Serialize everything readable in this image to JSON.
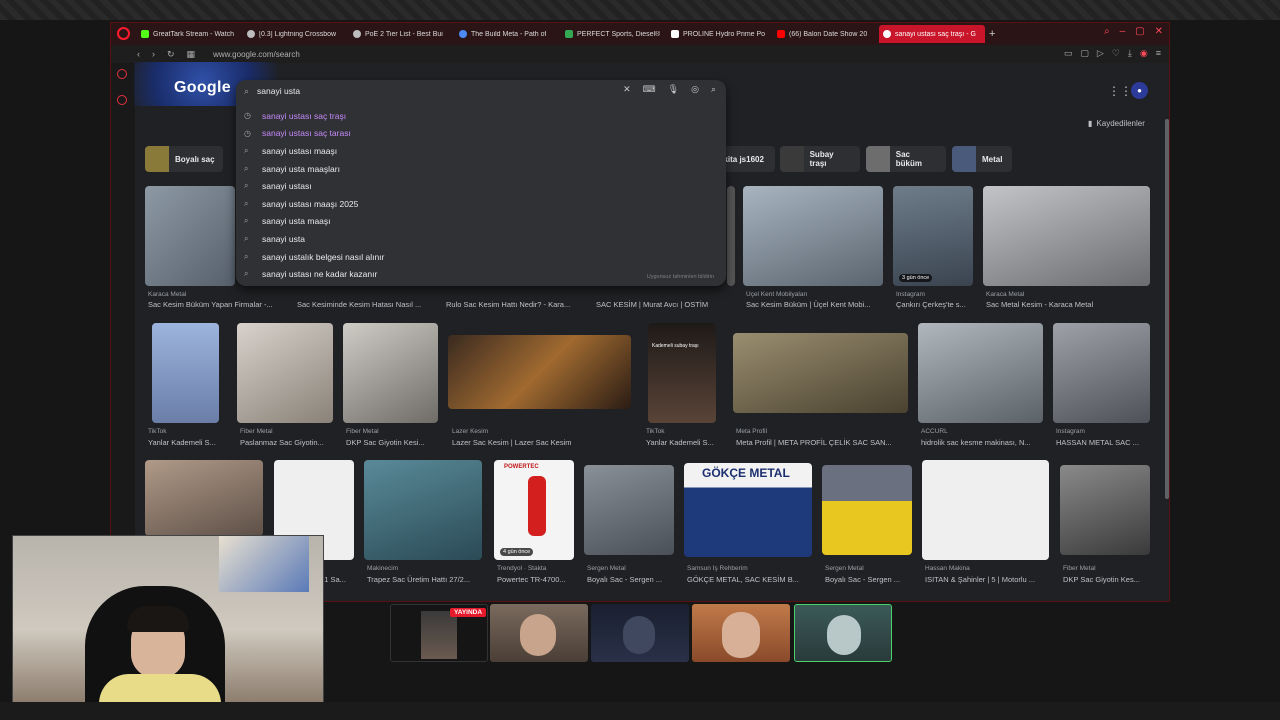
{
  "browser": {
    "tabs": [
      {
        "title": "GreatTark Stream - Watch",
        "color": "#53fc18"
      },
      {
        "title": "[0.3] Lightning Crossbow",
        "color": "#bdbdbd"
      },
      {
        "title": "PoE 2 Tier List - Best Bui",
        "color": "#bdbdbd"
      },
      {
        "title": "The Build Meta - Path of",
        "color": "#4c8bf5"
      },
      {
        "title": "PERFECT Sports, Diesel®",
        "color": "#34a853"
      },
      {
        "title": "PROLINE Hydro Prime Po",
        "color": "#ffffff"
      },
      {
        "title": "(66) Balon Date Show 20",
        "color": "#ff0000"
      },
      {
        "title": "sanayi ustası saç traşı - G",
        "color": "#ffffff"
      }
    ],
    "url": "www.google.com/search"
  },
  "google": {
    "logo": "Google",
    "saved_label": "Kaydedilenler",
    "avatar_letter": "●"
  },
  "search": {
    "query": "sanayi usta",
    "suggestions": [
      {
        "text": "sanayi ustası saç traşı",
        "type": "history"
      },
      {
        "text": "sanayi ustası saç tarası",
        "type": "history"
      },
      {
        "text": "sanayi ustası maaşı",
        "type": "search"
      },
      {
        "text": "sanayi usta maaşları",
        "type": "search"
      },
      {
        "text": "sanayi ustası",
        "type": "search"
      },
      {
        "text": "sanayi ustası maaşı 2025",
        "type": "search"
      },
      {
        "text": "sanayi usta maaşı",
        "type": "search"
      },
      {
        "text": "sanayi usta",
        "type": "search"
      },
      {
        "text": "sanayi ustalık belgesi nasıl alınır",
        "type": "search"
      },
      {
        "text": "sanayi ustası ne kadar kazanır",
        "type": "search"
      }
    ],
    "footer": "Uygunsuz tahminleri bildirin"
  },
  "chips": [
    {
      "label": "Boyalı saç",
      "color": "#8a7a3a"
    },
    {
      "label": "akita js1602",
      "color": "#5a5a5a"
    },
    {
      "label": "Subay traşı",
      "color": "#3a3a3a"
    },
    {
      "label": "Sac büküm",
      "color": "#6d6d6d"
    },
    {
      "label": "Metal",
      "color": "#4a5a7a"
    }
  ],
  "results": {
    "row1": [
      {
        "caption": "Sac Kesim Büküm Yapan Firmalar -...",
        "source": "Karaca Metal",
        "color": "#6a7480"
      },
      {
        "caption": "Sac Kesiminde Kesim Hatası Nasıl ...",
        "source": "",
        "color": "#4a4a4a"
      },
      {
        "caption": "Rulo Sac Kesim Hattı Nedir? - Kara...",
        "source": "",
        "color": "#4a4a4a"
      },
      {
        "caption": "SAC KESİM | Murat Avcı | OSTİM",
        "source": "",
        "color": "#4a4a4a"
      },
      {
        "caption": "Sac Kesim Büküm | Üçel Kent Mobi...",
        "source": "Üçel Kent Mobilyaları",
        "color": "#7a8590"
      },
      {
        "caption": "Çankırı Çerkeş'te s...",
        "source": "Instagram",
        "color": "#5c6a78",
        "badge": "3 gün önce"
      },
      {
        "caption": "Sac Metal Kesim - Karaca Metal",
        "source": "Karaca Metal",
        "color": "#8c8e92"
      }
    ],
    "row2": [
      {
        "caption": "Yanlar Kademeli S...",
        "source": "TikTok",
        "color": "#8aa0c8"
      },
      {
        "caption": "Paslanmaz Sac Giyotin...",
        "source": "Fiber Metal",
        "color": "#b8b2ac"
      },
      {
        "caption": "DKP Sac Giyotin Kesi...",
        "source": "Fiber Metal",
        "color": "#9c9892"
      },
      {
        "caption": "Lazer Sac Kesim | Lazer Sac Kesim",
        "source": "Lazer Kesim",
        "color": "#5a4030"
      },
      {
        "caption": "Yanlar Kademeli S...",
        "source": "TikTok",
        "color": "#3a2a24",
        "overlay": "Kademeli subay traşı"
      },
      {
        "caption": "Meta Profil | META PROFİL ÇELİK SAC SAN...",
        "source": "Meta Profil",
        "color": "#7a7056"
      },
      {
        "caption": "hidrolik sac kesme makinası, N...",
        "source": "ACCURL",
        "color": "#8a9298"
      },
      {
        "caption": "HASSAN METAL SAC ...",
        "source": "Instagram",
        "color": "#7a7e84"
      }
    ],
    "row3": [
      {
        "caption": "",
        "source": "",
        "color": "#9a8a7a"
      },
      {
        "caption": "...1 Sa...",
        "source": "",
        "color": "#e8e8e8"
      },
      {
        "caption": "Trapez Sac Üretim Hattı 27/2...",
        "source": "Makinecim",
        "color": "#3a6a78"
      },
      {
        "caption": "Powertec TR-4700...",
        "source": "Trendyol · Stakta",
        "color": "#f0f0f0",
        "badge": "4 gün önce",
        "brand": "POWERTEC"
      },
      {
        "caption": "Boyalı Sac - Sergen ...",
        "source": "Sergen Metal",
        "color": "#6a7080"
      },
      {
        "caption": "GÖKÇE METAL, SAC KESİM B...",
        "source": "Samsun İş Rehberim",
        "color": "#1e3a7a",
        "brand": "GÖKÇE METAL"
      },
      {
        "caption": "Boyalı Sac - Sergen ...",
        "source": "Sergen Metal",
        "color": "#e8c820"
      },
      {
        "caption": "ISITAN & Şahinler | 5 | Motorlu ...",
        "source": "Hassan Makina",
        "color": "#efefef"
      },
      {
        "caption": "DKP Sac Giyotin Kes...",
        "source": "Fiber Metal",
        "color": "#6c6c6c"
      }
    ]
  },
  "stream": {
    "live_label": "YAYINDA"
  }
}
